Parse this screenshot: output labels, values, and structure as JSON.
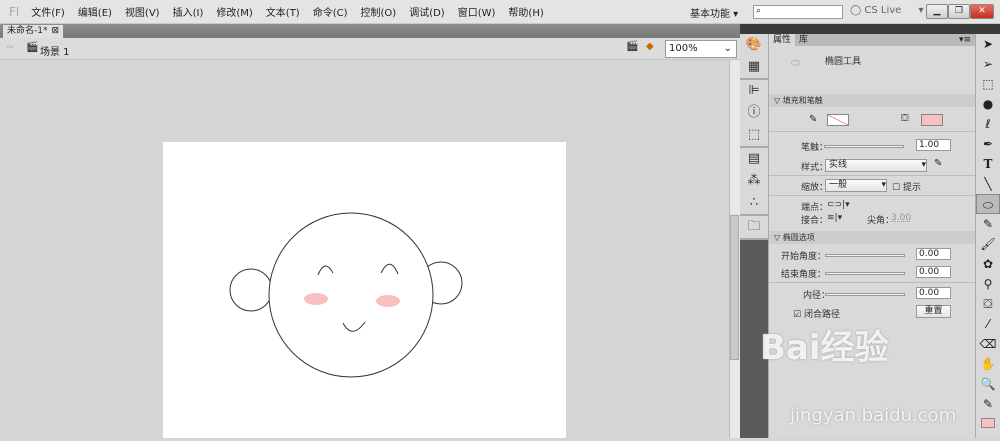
{
  "menu": {
    "logo": "Fl",
    "items": [
      "文件(F)",
      "编辑(E)",
      "视图(V)",
      "插入(I)",
      "修改(M)",
      "文本(T)",
      "命令(C)",
      "控制(O)",
      "调试(D)",
      "窗口(W)",
      "帮助(H)"
    ],
    "workspace": "基本功能",
    "search_placeholder": "",
    "cslive": "CS Live"
  },
  "document": {
    "tab": "未命名-1*",
    "scene": "场景 1",
    "zoom": "100%"
  },
  "panel": {
    "tabs": [
      "属性",
      "库"
    ],
    "tool_name": "椭圆工具",
    "fill_stroke": {
      "header": "填充和笔触",
      "stroke_label": "笔触：",
      "stroke_value": "1.00",
      "style_label": "样式：",
      "style_value": "实线",
      "scale_label": "缩放：",
      "scale_value": "一般",
      "hint_label": "提示",
      "cap_label": "端点：",
      "join_label": "接合：",
      "miter_label": "尖角：",
      "miter_value": "3.00",
      "fill_color": "#f8c0c0"
    },
    "oval": {
      "header": "椭圆选项",
      "start_label": "开始角度：",
      "start_value": "0.00",
      "end_label": "结束角度：",
      "end_value": "0.00",
      "inner_label": "内径：",
      "inner_value": "0.00",
      "close_label": "闭合路径",
      "close_checked": true,
      "reset": "重置"
    }
  },
  "watermark": {
    "logo": "Bai经验",
    "url": "jingyan.baidu.com"
  }
}
